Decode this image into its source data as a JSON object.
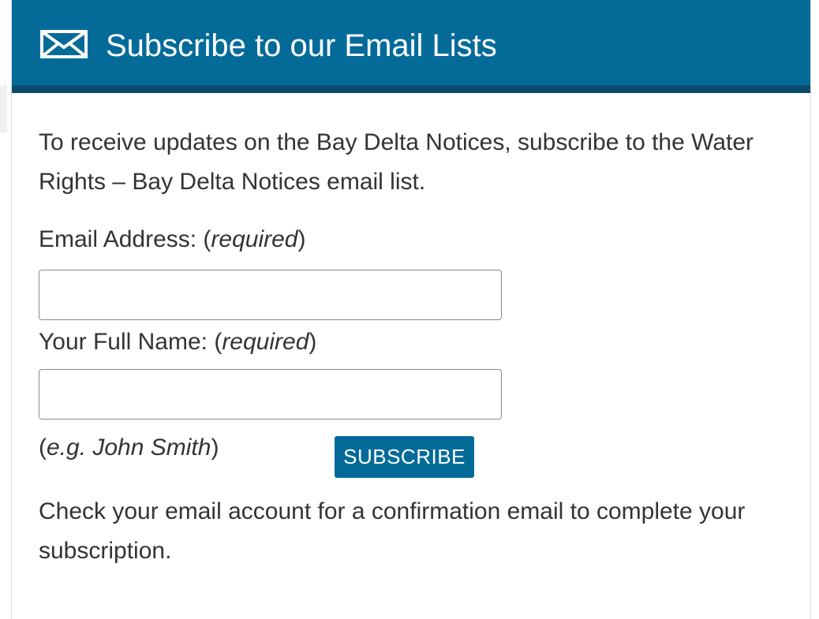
{
  "header": {
    "title": "Subscribe to our Email Lists",
    "icon": "envelope-icon",
    "background_color": "#046b99",
    "border_color": "#0a4c6a"
  },
  "body": {
    "intro_text": "To receive updates on the Bay Delta Notices, subscribe to the Water Rights – Bay Delta Notices email list.",
    "email_label": "Email Address: (",
    "email_required": "required",
    "email_label_close": ")",
    "email_value": "",
    "name_label": "Your Full Name: (",
    "name_required": "required",
    "name_label_close": ")",
    "name_value": "",
    "example_open": "(",
    "example_text": "e.g. John Smith",
    "example_close": ")",
    "subscribe_label": "SUBSCRIBE",
    "confirmation_text": "Check your email account for a confirmation email to complete your subscription."
  }
}
